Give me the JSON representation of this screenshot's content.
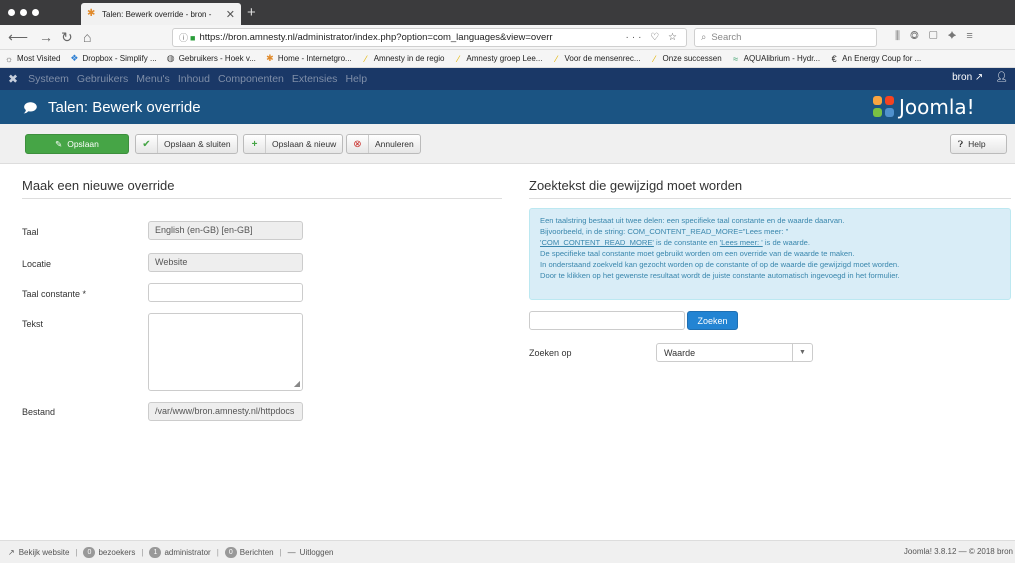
{
  "browser": {
    "tab_title": "Talen: Bewerk override - bron -",
    "url": "https://bron.amnesty.nl/administrator/index.php?option=com_languages&view=overr",
    "url_actions": "··· ♡ ☆",
    "search_placeholder": "Search",
    "bookmarks": [
      {
        "icon": "gear-icon",
        "glyph": "☼",
        "color": "#555",
        "label": "Most Visited"
      },
      {
        "icon": "dropbox-icon",
        "glyph": "❖",
        "color": "#2d7fd3",
        "label": "Dropbox - Simplify ..."
      },
      {
        "icon": "globe-icon",
        "glyph": "◍",
        "color": "#444",
        "label": "Gebruikers - Hoek v..."
      },
      {
        "icon": "joomla-icon",
        "glyph": "✱",
        "color": "#e08a2b",
        "label": "Home - Internetgro..."
      },
      {
        "icon": "amnesty-candle-icon",
        "glyph": "⁄",
        "color": "#e2b400",
        "label": "Amnesty in de regio"
      },
      {
        "icon": "amnesty-candle-icon",
        "glyph": "⁄",
        "color": "#e2b400",
        "label": "Amnesty groep Lee..."
      },
      {
        "icon": "amnesty-candle-icon",
        "glyph": "⁄",
        "color": "#e2b400",
        "label": "Voor de mensenrec..."
      },
      {
        "icon": "amnesty-candle-icon",
        "glyph": "⁄",
        "color": "#e2b400",
        "label": "Onze successen"
      },
      {
        "icon": "aqua-icon",
        "glyph": "≈",
        "color": "#3aa16b",
        "label": "AQUAlibrium - Hydr..."
      },
      {
        "icon": "energy-icon",
        "glyph": "€",
        "color": "#222",
        "label": "An Energy Coup for ..."
      }
    ]
  },
  "admin_menu": {
    "items": [
      "Systeem",
      "Gebruikers",
      "Menu's",
      "Inhoud",
      "Componenten",
      "Extensies",
      "Help"
    ],
    "site_link": "bron ↗",
    "user_icon": "user-icon"
  },
  "header": {
    "title": "Talen: Bewerk override",
    "logo_text": "Joomla!",
    "icon": "speech-bubble-icon"
  },
  "toolbar": {
    "save": "Opslaan",
    "save_close": "Opslaan & sluiten",
    "save_new": "Opslaan & nieuw",
    "cancel": "Annuleren",
    "help": "Help"
  },
  "left": {
    "title": "Maak een nieuwe override",
    "language_label": "Taal",
    "language_value": "English (en-GB) [en-GB]",
    "location_label": "Locatie",
    "location_value": "Website",
    "constant_label": "Taal constante *",
    "constant_value": "",
    "text_label": "Tekst",
    "file_label": "Bestand",
    "file_value": "/var/www/bron.amnesty.nl/httpdocs"
  },
  "right": {
    "title": "Zoektekst die gewijzigd moet worden",
    "info": {
      "line1": "Een taalstring bestaat uit twee delen: een specifieke taal constante en de waarde daarvan.",
      "line2": "Bijvoorbeeld, in de string: COM_CONTENT_READ_MORE=\"Lees meer: \"",
      "line3_a": "'COM_CONTENT_READ_MORE'",
      "line3_b": " is de constante en ",
      "line3_c": "'Lees meer: '",
      "line3_d": " is de waarde.",
      "line4": "De specifieke taal constante moet gebruikt worden om een override van de waarde te maken.",
      "line5": "In onderstaand zoekveld kan gezocht worden op de constante of op de waarde die gewijzigd moet worden.",
      "line6": "Door te klikken op het gewenste resultaat wordt de juiste constante automatisch ingevoegd in het formulier."
    },
    "search_button": "Zoeken",
    "search_on_label": "Zoeken op",
    "search_on_value": "Waarde"
  },
  "status": {
    "view_site": "Bekijk website",
    "visitors_count": "0",
    "visitors_label": "bezoekers",
    "admin_count": "1",
    "admin_label": "administrator",
    "messages_count": "0",
    "messages_label": "Berichten",
    "logout": "Uitloggen",
    "version": "Joomla! 3.8.12 — © 2018 bron"
  },
  "colors": {
    "admin_bar": "#1a3867",
    "header_bar": "#1b5483",
    "save_green": "#46a546",
    "info_bg": "#d9edf7",
    "primary_blue": "#2384d3"
  }
}
